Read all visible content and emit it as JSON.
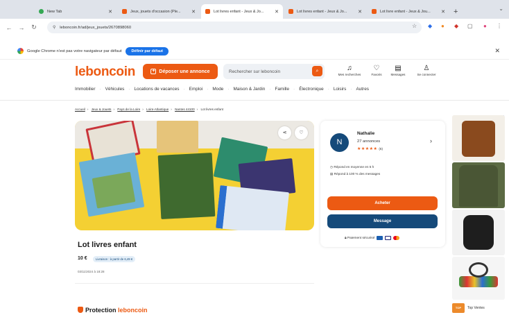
{
  "browser": {
    "tabs": [
      {
        "label": "New Tab",
        "favicon_color": "#34a853"
      },
      {
        "label": "Jeux, jouets d'occasion (Ple...",
        "favicon_color": "#ec5a13"
      },
      {
        "label": "Lot livres enfant - Jeux & Jo...",
        "favicon_color": "#ec5a13"
      },
      {
        "label": "Lot livres enfant - Jeux & Jo...",
        "favicon_color": "#ec5a13"
      },
      {
        "label": "Lot livre enfant - Jeux & Jou...",
        "favicon_color": "#ec5a13"
      }
    ],
    "new_tab": "+",
    "url": "leboncoin.fr/ad/jeux_jouets/2670898060",
    "infobar_text": "Google Chrome n'est pas votre navigateur par défaut",
    "infobar_button": "Définir par défaut"
  },
  "header": {
    "logo": "leboncoin",
    "post_button": "Déposer une annonce",
    "search_placeholder": "Rechercher sur leboncoin",
    "nav": [
      {
        "label": "Mes recherches",
        "icon": "bell-icon"
      },
      {
        "label": "Favoris",
        "icon": "heart-icon"
      },
      {
        "label": "Messages",
        "icon": "chat-icon"
      },
      {
        "label": "Se connecter",
        "icon": "user-icon"
      }
    ],
    "categories": [
      "Immobilier",
      "Véhicules",
      "Locations de vacances",
      "Emploi",
      "Mode",
      "Maison & Jardin",
      "Famille",
      "Électronique",
      "Loisirs",
      "Autres"
    ]
  },
  "breadcrumb": [
    "Accueil",
    "Jeux & Jouets",
    "Pays de la Loire",
    "Loire-Atlantique",
    "Nantes 44100",
    "Lot livres enfant"
  ],
  "listing": {
    "title": "Lot livres enfant",
    "price": "10 €",
    "delivery": "Livraison : à partir de 6,49 €",
    "date": "03/11/2024 à 18:28",
    "protection_prefix": "Protection",
    "protection_brand": "leboncoin"
  },
  "seller": {
    "initial": "N",
    "name": "Nathalie",
    "ads_count": "27 annonces",
    "stars": "★★★★★",
    "reviews": "(6)",
    "response_time": "Répond en moyenne en 5 h",
    "response_rate": "Répond à 100 % des messages",
    "buy_button": "Acheter",
    "message_button": "Message",
    "secure_payment": "Paiement sécurisé"
  },
  "ads": {
    "top_label": "Top Ventes",
    "top_logo": "TOP"
  },
  "colors": {
    "brand_orange": "#ec5a13",
    "brand_blue": "#154a7a"
  }
}
